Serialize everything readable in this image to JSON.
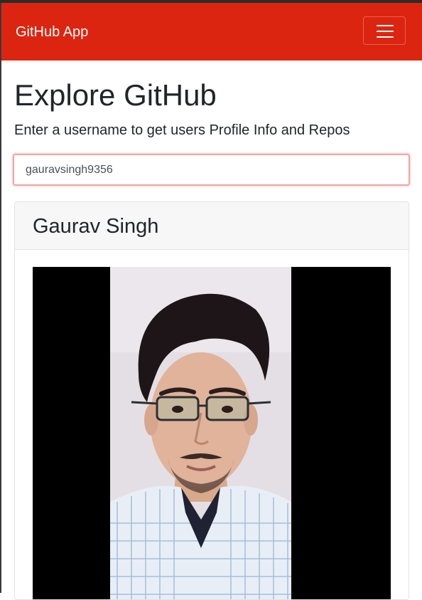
{
  "navbar": {
    "brand": "GitHub App",
    "toggler_icon": "hamburger-menu-icon",
    "color": "#dc2510"
  },
  "main": {
    "title": "Explore GitHub",
    "lead": "Enter a username to get users Profile Info and Repos"
  },
  "search": {
    "value": "gauravsingh9356"
  },
  "profile": {
    "name": "Gaurav Singh",
    "avatar_icon": "profile-photo"
  }
}
